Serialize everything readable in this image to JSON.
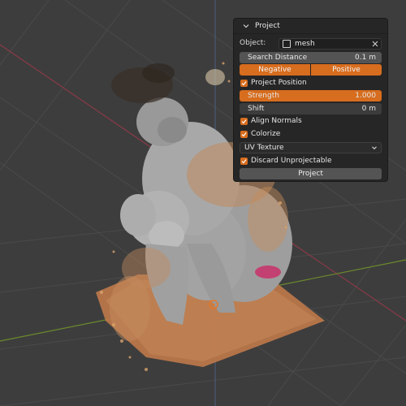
{
  "panel": {
    "title": "Project",
    "object_label": "Object:",
    "object_value": "mesh",
    "search_distance": {
      "label": "Search Distance",
      "value": "0.1 m"
    },
    "direction": {
      "negative": "Negative",
      "positive": "Positive"
    },
    "project_position": {
      "label": "Project Position",
      "checked": true
    },
    "strength": {
      "label": "Strength",
      "value": "1.000"
    },
    "shift": {
      "label": "Shift",
      "value": "0 m"
    },
    "align_normals": {
      "label": "Align Normals",
      "checked": true
    },
    "colorize": {
      "label": "Colorize",
      "checked": true
    },
    "uv_texture": {
      "value": "UV Texture"
    },
    "discard_unprojectable": {
      "label": "Discard Unprojectable",
      "checked": true
    },
    "project_button": "Project"
  },
  "colors": {
    "accent": "#d76d1e",
    "viewport_bg": "#3d3d3d",
    "panel_bg": "#262626"
  },
  "icons": {
    "panel_collapse": "chevron-down-icon",
    "object": "mesh-object-icon",
    "clear": "close-icon",
    "dropdown": "chevron-down-icon",
    "checkbox": "checkmark-icon",
    "origin": "object-origin-icon"
  }
}
